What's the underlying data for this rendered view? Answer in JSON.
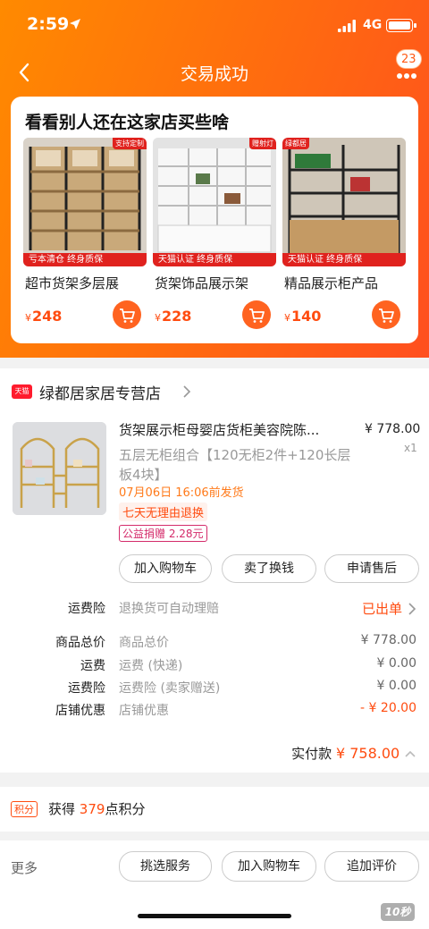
{
  "status": {
    "time": "2:59",
    "network": "4G"
  },
  "nav": {
    "title": "交易成功",
    "badge": "23"
  },
  "recommend": {
    "title": "看看别人还在这家店买些啥",
    "products": [
      {
        "name": "超市货架多层展",
        "currency": "¥",
        "price": "248",
        "tag": "支持定制",
        "ribbon": "亏本清仓  终身质保"
      },
      {
        "name": "货架饰品展示架",
        "currency": "¥",
        "price": "228",
        "tag": "赠射灯",
        "ribbon": "天猫认证  终身质保"
      },
      {
        "name": "精品展示柜产品",
        "currency": "¥",
        "price": "140",
        "tag": "绿都居",
        "ribbon": "天猫认证  终身质保"
      }
    ]
  },
  "order": {
    "shop_badge": "天猫",
    "shop_name": "绿都居家居专营店",
    "item": {
      "title": "货架展示柜母婴店货柜美容院陈...",
      "price": "¥ 778.00",
      "qty": "x1",
      "spec": "五层无柜组合【120无柜2件+120长层板4块】",
      "ship": "07月06日 16:06前发货",
      "tag1": "七天无理由退换",
      "tag2": "公益捐赠 2.28元"
    },
    "actions": [
      "加入购物车",
      "卖了换钱",
      "申请售后"
    ],
    "insurance": {
      "label": "运费险",
      "desc": "退换货可自动理赔",
      "value": "已出单"
    },
    "fees": [
      {
        "label": "商品总价",
        "desc": "商品总价",
        "value": "¥ 778.00"
      },
      {
        "label": "运费",
        "desc": "运费 (快递)",
        "value": "¥ 0.00"
      },
      {
        "label": "运费险",
        "desc": "运费险 (卖家赠送)",
        "value": "¥ 0.00"
      },
      {
        "label": "店铺优惠",
        "desc": "店铺优惠",
        "value": "- ¥ 20.00"
      }
    ],
    "total_label": "实付款",
    "total_value": "¥ 758.00"
  },
  "points": {
    "label": "积分",
    "prefix": "获得",
    "num": "379",
    "suffix": "点积分"
  },
  "bottom": {
    "more": "更多",
    "buttons": [
      "挑选服务",
      "加入购物车",
      "追加评价"
    ]
  },
  "watermark": "10秒"
}
